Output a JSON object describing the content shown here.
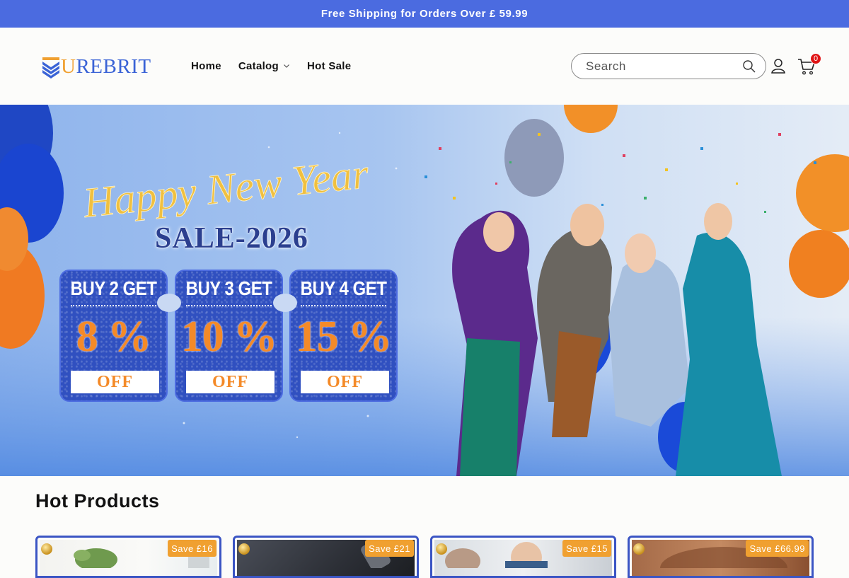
{
  "announcement": {
    "text": "Free Shipping for Orders Over £ 59.99"
  },
  "brand": {
    "logo_u": "U",
    "logo_rest": "REBRIT"
  },
  "nav": {
    "items": [
      {
        "label": "Home"
      },
      {
        "label": "Catalog"
      },
      {
        "label": "Hot Sale"
      }
    ]
  },
  "search": {
    "placeholder": "Search"
  },
  "cart": {
    "count": "0"
  },
  "hero": {
    "script_text": "Happy New Year",
    "sale_text": "SALE-2026",
    "coupons": [
      {
        "buy": "BUY 2 GET",
        "percent": "8 %",
        "off": "OFF"
      },
      {
        "buy": "BUY 3 GET",
        "percent": "10 %",
        "off": "OFF"
      },
      {
        "buy": "BUY 4 GET",
        "percent": "15 %",
        "off": "OFF"
      }
    ]
  },
  "hot_products": {
    "title": "Hot Products",
    "cards": [
      {
        "save": "Save £16"
      },
      {
        "save": "Save £21"
      },
      {
        "save": "Save £15"
      },
      {
        "save": "Save £66.99"
      }
    ]
  },
  "colors": {
    "accent": "#4b6be0",
    "brand_blue": "#3a63d6",
    "brand_orange": "#f0a030",
    "badge_red": "#e01515"
  },
  "icons": [
    "search-icon",
    "account-icon",
    "cart-icon",
    "chevron-down-icon",
    "ornament-icon"
  ]
}
